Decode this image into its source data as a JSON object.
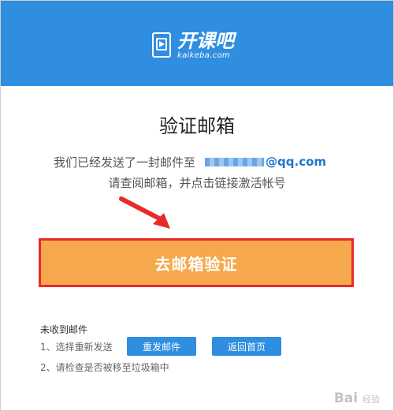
{
  "header": {
    "logo_main": "开课吧",
    "logo_sub": "kaikeba.com",
    "background": "#2f8ee0"
  },
  "content": {
    "title": "验证邮箱",
    "line1_prefix": "我们已经发送了一封邮件至",
    "email_domain": "@qq.com",
    "line2": "请查阅邮箱，并点击链接激活帐号"
  },
  "verify_button": {
    "label": "去邮箱验证",
    "color": "#f5a94c",
    "highlight": "#e82a2a"
  },
  "help": {
    "title": "未收到邮件",
    "step1": "1、选择重新发送",
    "step2": "2、请检查是否被移至垃圾箱中",
    "resend_label": "重发邮件",
    "home_label": "返回首页"
  },
  "watermark": {
    "text": "Bai",
    "sub": "经验"
  }
}
